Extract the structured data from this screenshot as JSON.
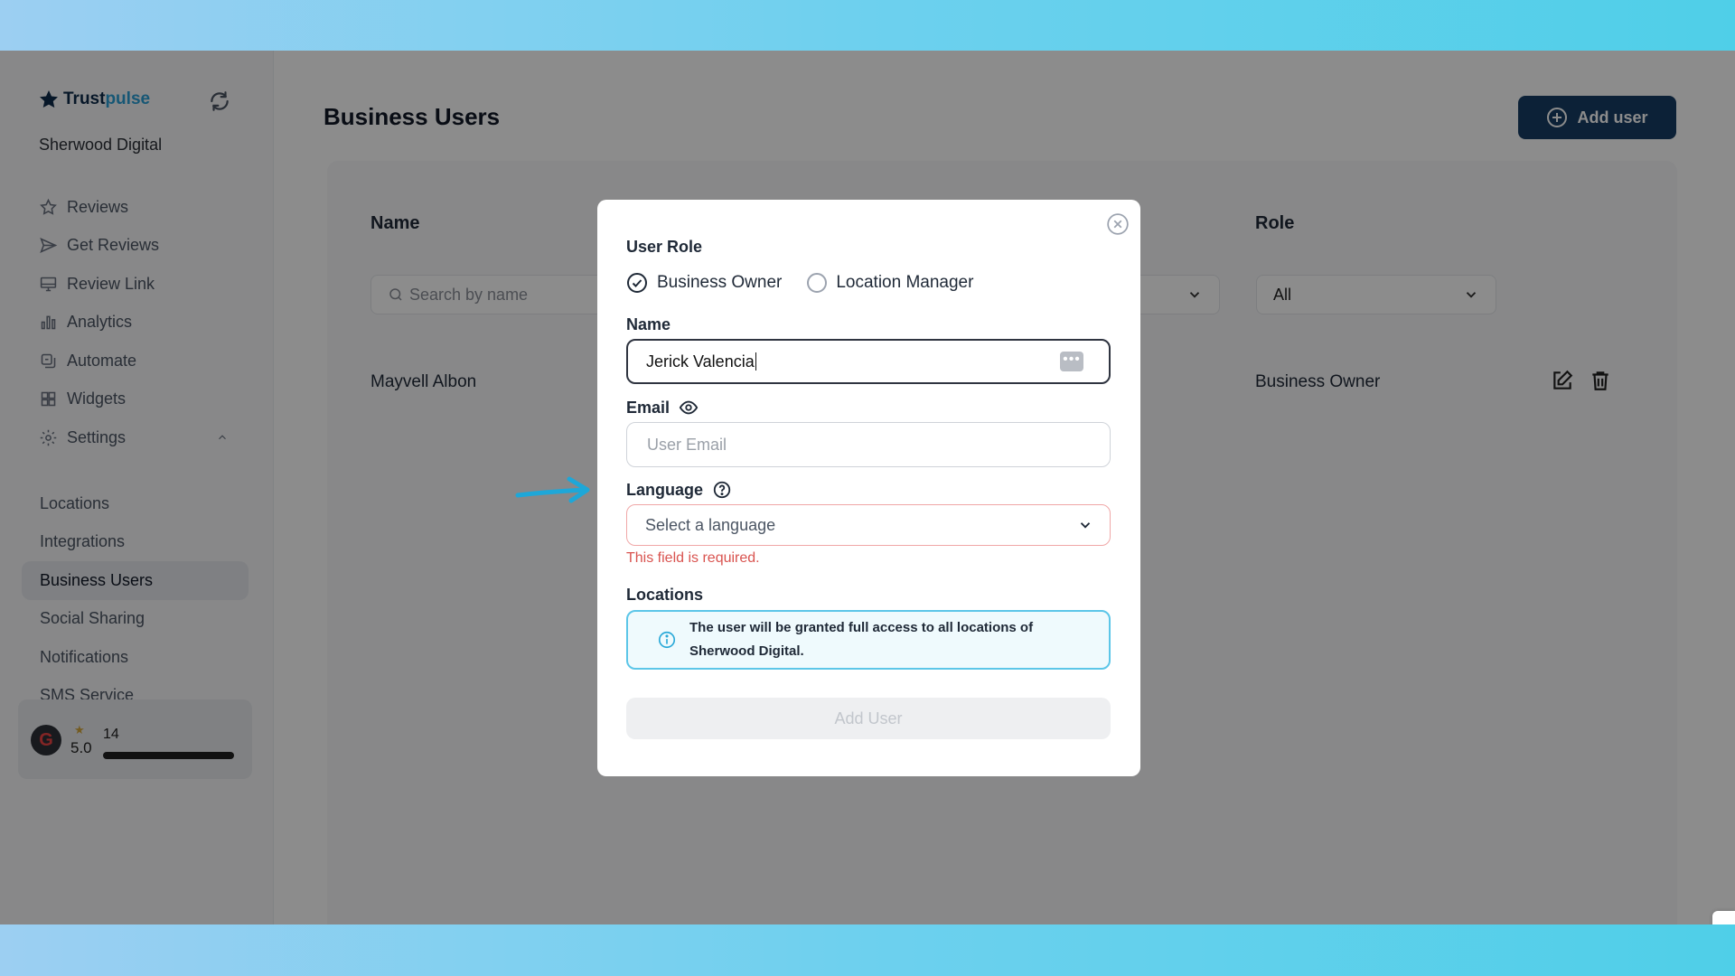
{
  "brand": {
    "name_part1": "Trust",
    "name_part2": "pulse"
  },
  "org_name": "Sherwood Digital",
  "nav": [
    {
      "label": "Reviews",
      "icon": "star-icon"
    },
    {
      "label": "Get Reviews",
      "icon": "send-icon"
    },
    {
      "label": "Review Link",
      "icon": "monitor-icon"
    },
    {
      "label": "Analytics",
      "icon": "bar-chart-icon"
    },
    {
      "label": "Automate",
      "icon": "automate-icon"
    },
    {
      "label": "Widgets",
      "icon": "widgets-icon"
    },
    {
      "label": "Settings",
      "icon": "gear-icon"
    }
  ],
  "settings_sub": [
    "Locations",
    "Integrations",
    "Business Users",
    "Social Sharing",
    "Notifications",
    "SMS Service"
  ],
  "rating_card": {
    "rating": "5.0",
    "count": "14"
  },
  "page": {
    "title": "Business Users",
    "add_user_label": "Add user",
    "columns": {
      "name": "Name",
      "role": "Role"
    },
    "search_placeholder": "Search by name",
    "role_filter": "All",
    "rows": [
      {
        "name": "Mayvell Albon",
        "role": "Business Owner"
      }
    ]
  },
  "modal": {
    "user_role_label": "User Role",
    "roles": [
      "Business Owner",
      "Location Manager"
    ],
    "selected_role": "Business Owner",
    "name_label": "Name",
    "name_value": "Jerick Valencia",
    "email_label": "Email",
    "email_placeholder": "User Email",
    "language_label": "Language",
    "language_placeholder": "Select a language",
    "language_error": "This field is required.",
    "locations_label": "Locations",
    "locations_info_line1": "The user will be granted full access to all locations of",
    "locations_info_line2": "Sherwood Digital.",
    "submit_label": "Add User"
  },
  "colors": {
    "accent": "#163d64",
    "brand_blue": "#2a9fd6",
    "error": "#d9534f",
    "info_border": "#5cc6e8",
    "pointer_arrow": "#1ea7d8"
  }
}
